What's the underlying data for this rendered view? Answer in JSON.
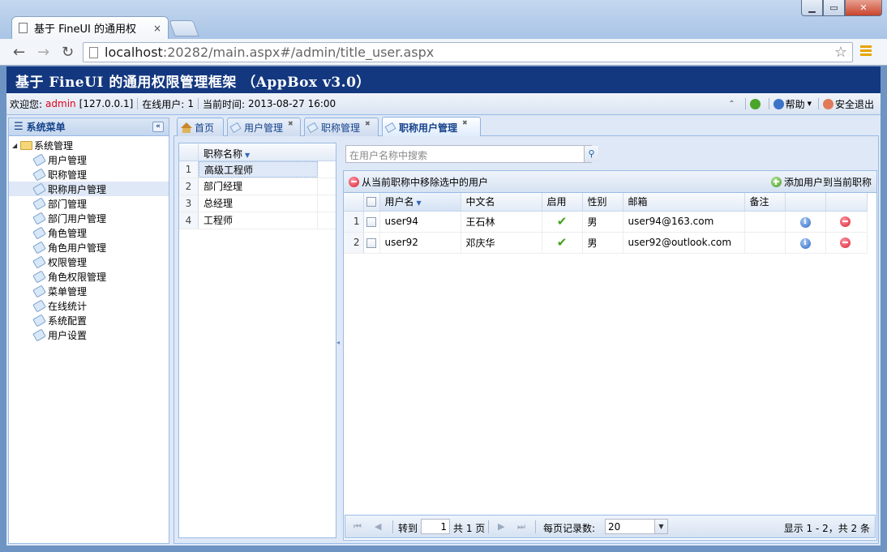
{
  "browser": {
    "tab_title": "基于 FineUI 的通用权",
    "tab_close": "×",
    "url_host": "localhost",
    "url_rest": ":20282/main.aspx#/admin/title_user.aspx"
  },
  "app": {
    "title": "基于 FineUI 的通用权限管理框架 （AppBox v3.0）"
  },
  "statusbar": {
    "welcome_label": "欢迎您:",
    "username": "admin",
    "ip": "[127.0.0.1]",
    "online_label": "在线用户:",
    "online_count": "1",
    "time_label": "当前时间:",
    "time_value": "2013-08-27 16:00",
    "help_label": "帮助",
    "logout_label": "安全退出"
  },
  "sidebar": {
    "title": "系统菜单",
    "root": "系统管理",
    "items": [
      "用户管理",
      "职称管理",
      "职称用户管理",
      "部门管理",
      "部门用户管理",
      "角色管理",
      "角色用户管理",
      "权限管理",
      "角色权限管理",
      "菜单管理",
      "在线统计",
      "系统配置",
      "用户设置"
    ]
  },
  "tabs": [
    "首页",
    "用户管理",
    "职称管理",
    "职称用户管理"
  ],
  "left_grid": {
    "header": "职称名称",
    "rows": [
      {
        "n": "1",
        "name": "高级工程师"
      },
      {
        "n": "2",
        "name": "部门经理"
      },
      {
        "n": "3",
        "name": "总经理"
      },
      {
        "n": "4",
        "name": "工程师"
      }
    ]
  },
  "search": {
    "placeholder": "在用户名称中搜索"
  },
  "toolbar": {
    "remove_label": "从当前职称中移除选中的用户",
    "add_label": "添加用户到当前职称"
  },
  "right_grid": {
    "headers": {
      "username": "用户名",
      "chinese_name": "中文名",
      "enabled": "启用",
      "gender": "性别",
      "email": "邮箱",
      "remark": "备注"
    },
    "rows": [
      {
        "n": "1",
        "username": "user94",
        "chinese_name": "王石林",
        "gender": "男",
        "email": "user94@163.com",
        "remark": ""
      },
      {
        "n": "2",
        "username": "user92",
        "chinese_name": "邓庆华",
        "gender": "男",
        "email": "user92@outlook.com",
        "remark": ""
      }
    ]
  },
  "pager": {
    "goto_label": "转到",
    "page_value": "1",
    "total_pages": "共 1 页",
    "page_size_label": "每页记录数:",
    "page_size": "20",
    "summary": "显示 1 - 2，共 2 条"
  }
}
